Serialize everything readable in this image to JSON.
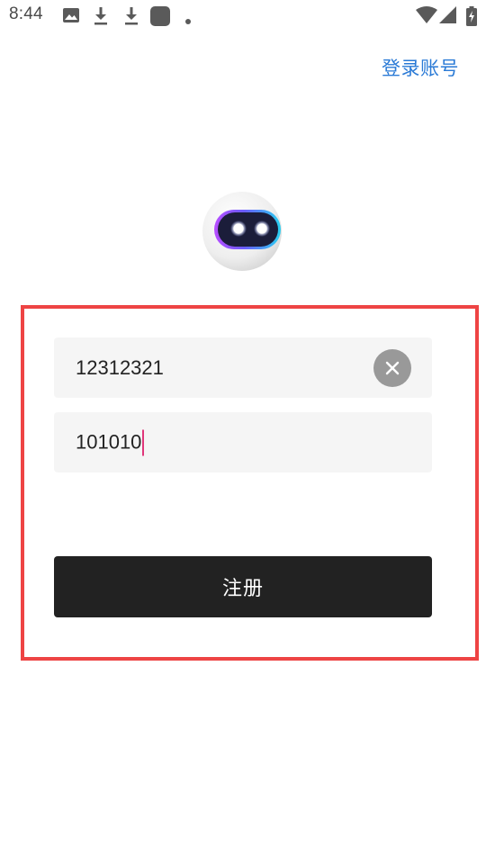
{
  "status_bar": {
    "time": "8:44",
    "icons": [
      "image-icon",
      "download-icon",
      "download-icon",
      "app-icon",
      "dot-icon",
      "wifi-icon",
      "cellular-icon",
      "battery-charging-icon"
    ]
  },
  "header": {
    "login_link": "登录账号"
  },
  "logo": {
    "icon": "robot-face-icon"
  },
  "form": {
    "account_value": "12312321",
    "password_value": "101010",
    "clear_icon": "close-icon",
    "register_label": "注册"
  },
  "colors": {
    "link": "#2a7ad6",
    "button_bg": "#222222",
    "field_bg": "#f5f5f5",
    "highlight": "#ee4444",
    "caret": "#e0377a"
  }
}
